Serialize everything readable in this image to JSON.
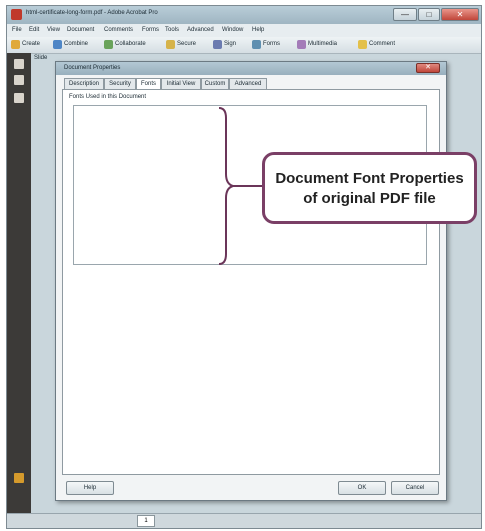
{
  "window": {
    "title": "html-certificate-long-form.pdf - Adobe Acrobat Pro",
    "minimize_glyph": "—",
    "maximize_glyph": "□",
    "close_glyph": "✕"
  },
  "menubar": [
    "File",
    "Edit",
    "View",
    "Document",
    "Comments",
    "Forms",
    "Tools",
    "Advanced",
    "Window",
    "Help"
  ],
  "toolbar": [
    "Create",
    "Combine",
    "Collaborate",
    "Secure",
    "Sign",
    "Forms",
    "Multimedia",
    "Comment"
  ],
  "toolbar_icon_colors": [
    "#e0a93a",
    "#4f86c6",
    "#6aa35b",
    "#d6b34a",
    "#6b7bb0",
    "#5f8fb0",
    "#a37bb8",
    "#e3c04a"
  ],
  "left_panel": {
    "second_row_label": "Slide"
  },
  "dialog": {
    "title": "Document Properties",
    "close_glyph": "✕",
    "tabs": [
      "Description",
      "Security",
      "Fonts",
      "Initial View",
      "Custom",
      "Advanced"
    ],
    "active_tab": "Fonts",
    "section_label": "Fonts Used in this Document",
    "buttons": {
      "help": "Help",
      "ok": "OK",
      "cancel": "Cancel"
    }
  },
  "annotation": {
    "line1": "Document Font Properties",
    "line2": "of original PDF file",
    "border_color": "#7a3f66",
    "brace_color": "#6b3559"
  },
  "statusbar": {
    "page": "1"
  }
}
